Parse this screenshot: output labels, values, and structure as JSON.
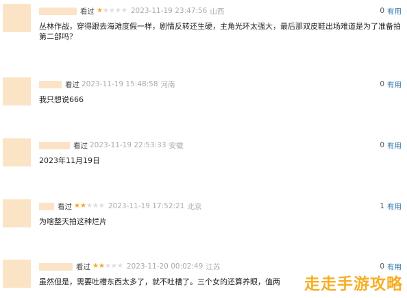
{
  "comments": [
    {
      "watched_label": "看过",
      "rating": 1,
      "time": "2023-11-19 23:47:56",
      "location": "山西",
      "vote_count": "0",
      "useful_label": "有用",
      "text": "丛林作战，穿得跟去海滩度假一样，剧情反转还生硬，主角光环太强大，最后那双皮鞋出场难道是为了准备拍第二部吗？"
    },
    {
      "watched_label": "看过",
      "rating": 0,
      "time": "2023-11-19 15:48:58",
      "location": "河南",
      "vote_count": "0",
      "useful_label": "有用",
      "text": "我只想说666"
    },
    {
      "watched_label": "看过",
      "rating": 0,
      "time": "2023-11-19 22:53:33",
      "location": "安徽",
      "vote_count": "0",
      "useful_label": "有用",
      "text": "2023年11月19日"
    },
    {
      "watched_label": "看过",
      "rating": 2,
      "time": "2023-11-19 17:52:21",
      "location": "北京",
      "vote_count": "1",
      "useful_label": "有用",
      "text": "为啥整天拍这种烂片"
    },
    {
      "watched_label": "看过",
      "rating": 2,
      "time": "2023-11-20 00:02:49",
      "location": "江苏",
      "vote_count": "0",
      "useful_label": "有用",
      "text": "虽然但是，需要吐槽东西太多了，就不吐槽了。三个女的还算养眼，值两"
    }
  ],
  "watermark": "走走手游攻略"
}
